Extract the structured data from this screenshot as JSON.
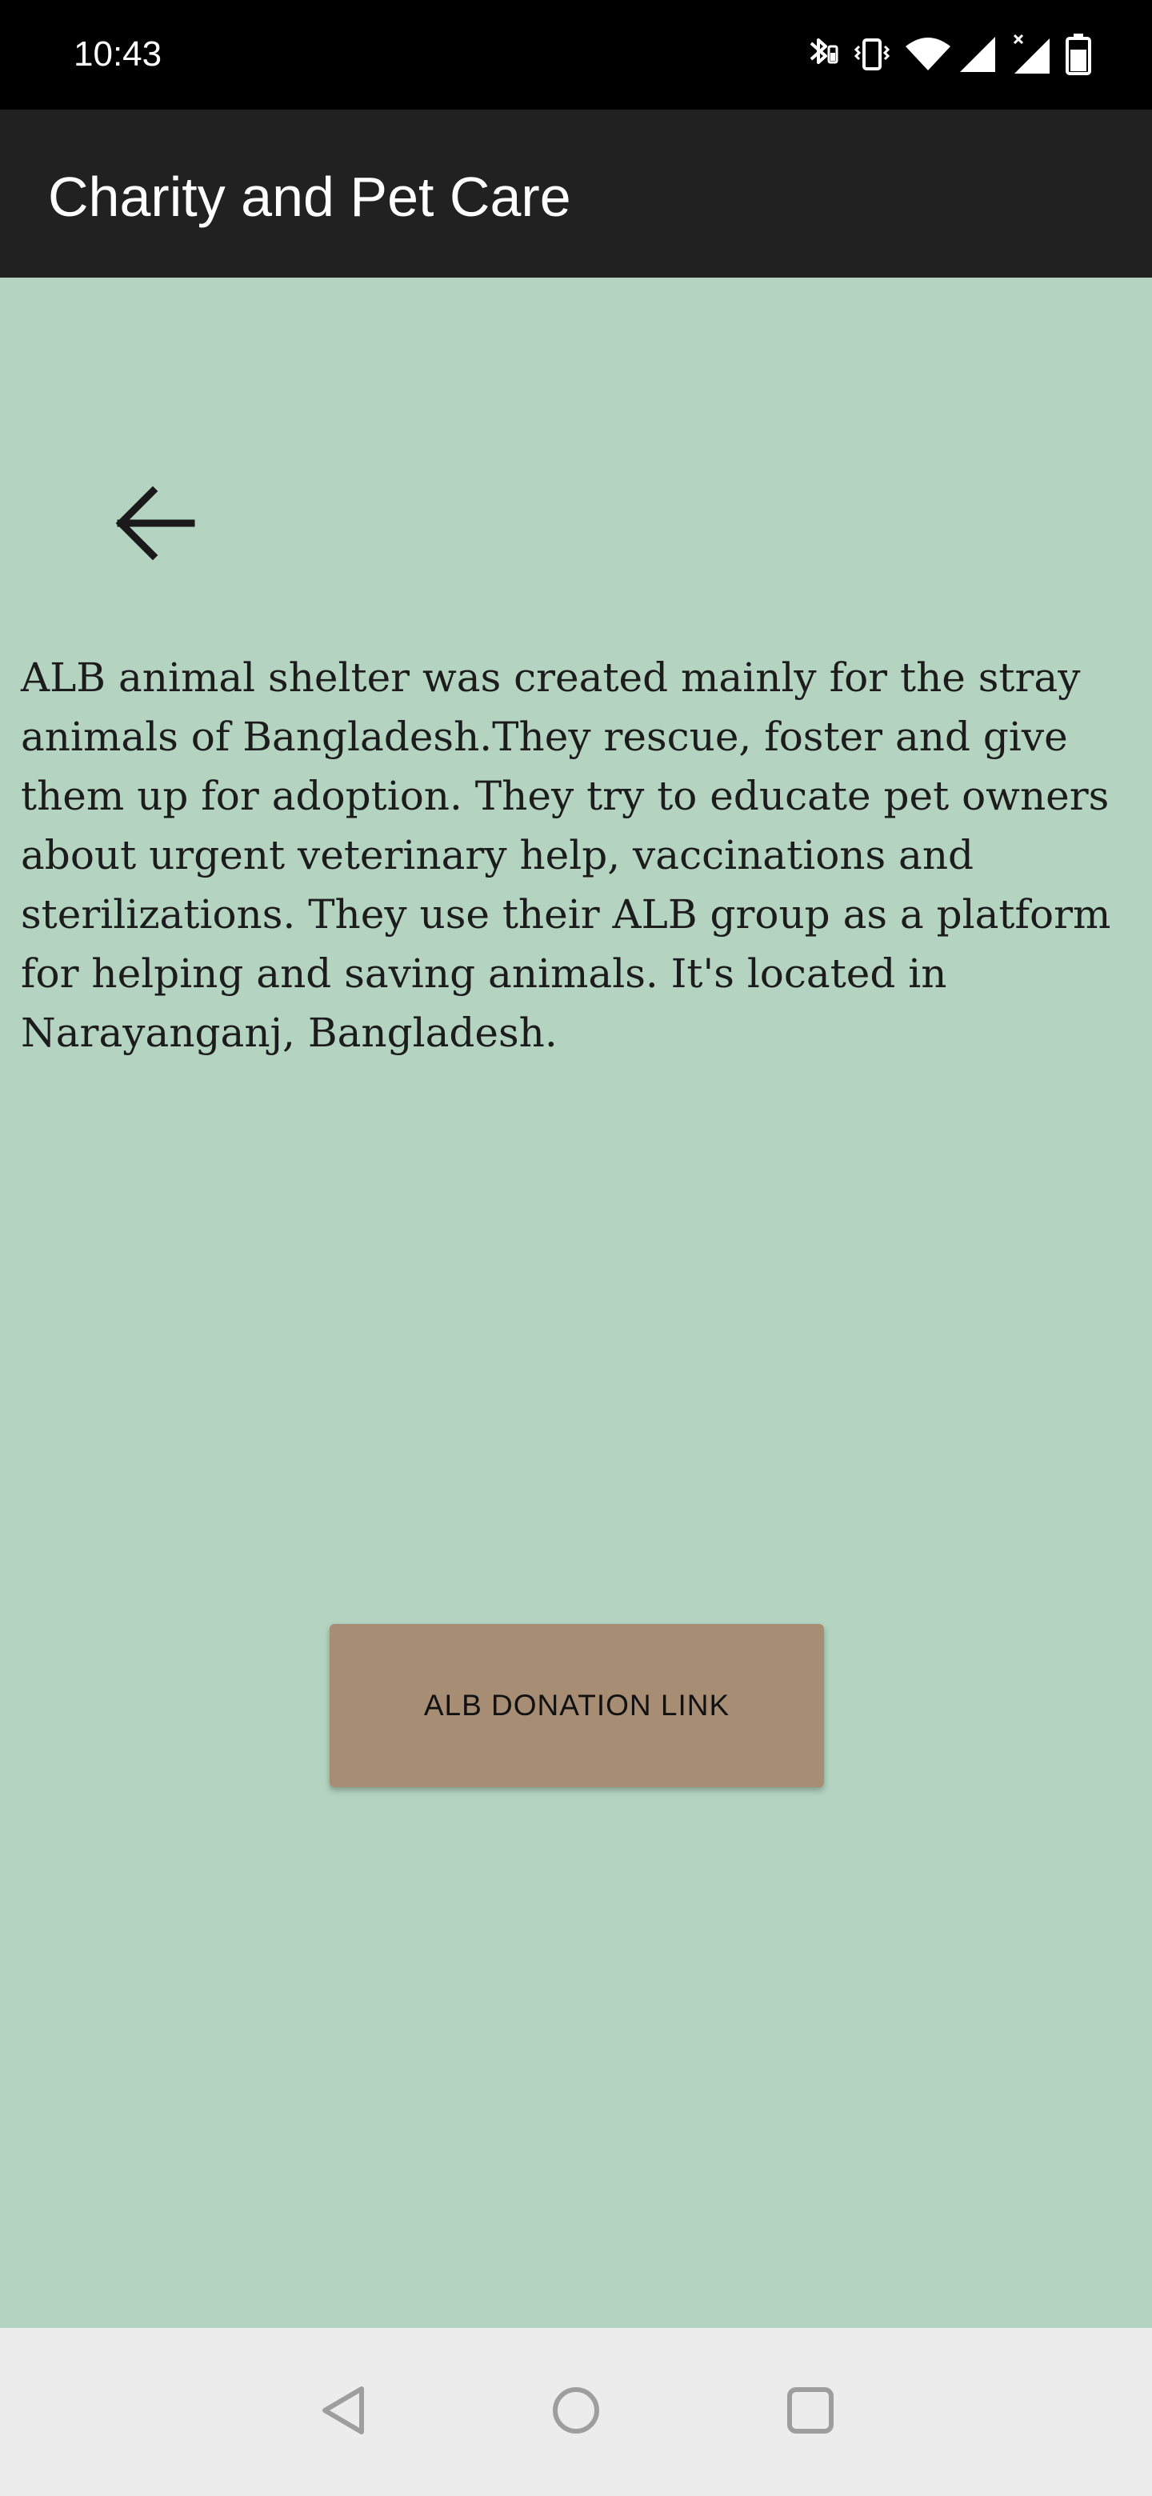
{
  "status_bar": {
    "time": "10:43",
    "icons": [
      "bluetooth-icon",
      "vibrate-icon",
      "wifi-icon",
      "signal-icon",
      "signal-no-data-icon",
      "battery-icon"
    ]
  },
  "app_bar": {
    "title": "Charity and Pet Care"
  },
  "back_button": {
    "icon": "arrow-back-icon"
  },
  "content": {
    "description": "ALB animal shelter was created mainly for the stray animals of Bangladesh.They rescue, foster and give them up for adoption. They try to educate pet owners about urgent veterinary help, vaccinations and sterilizations. They use their ALB group as a platform for helping and saving animals. It's located in Narayanganj, Bangladesh."
  },
  "donation_button": {
    "label": "ALB DONATION LINK"
  },
  "nav_bar": {
    "icons": [
      "nav-back-icon",
      "nav-home-icon",
      "nav-recents-icon"
    ]
  },
  "colors": {
    "background": "#b4d4c1",
    "app_bar": "#212121",
    "status_bar": "#000000",
    "button": "#a78d73",
    "nav_bar": "#ececec"
  }
}
